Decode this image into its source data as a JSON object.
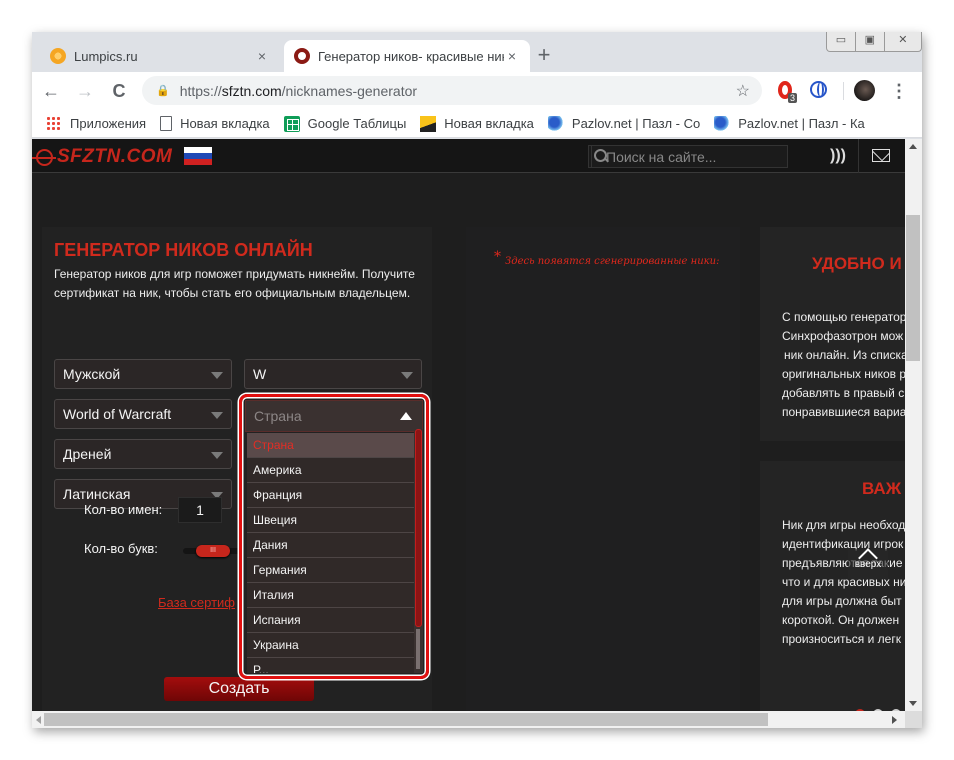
{
  "browser": {
    "tabs": [
      {
        "title": "Lumpics.ru",
        "favicon_color": "#f5a623",
        "active": false
      },
      {
        "title": "Генератор ников- красивые ник",
        "favicon_color": "#8b1a14",
        "active": true
      }
    ],
    "new_tab_label": "+",
    "close_glyph": "×",
    "window_controls": {
      "minimize": "▭",
      "maximize": "▣",
      "close": "✕"
    },
    "nav": {
      "back": "←",
      "forward": "→",
      "reload": "C"
    },
    "url": {
      "scheme": "https://",
      "host": "sfztn.com",
      "path": "/nicknames-generator"
    },
    "star_glyph": "☆",
    "opera_badge": "3",
    "menu_glyph": "⋮",
    "bookmarks": [
      {
        "label": "Приложения",
        "icon": "apps-grid-icon"
      },
      {
        "label": "Новая вкладка",
        "icon": "page-icon"
      },
      {
        "label": "Google Таблицы",
        "icon": "google-sheets-icon"
      },
      {
        "label": "Новая вкладка",
        "icon": "image-icon"
      },
      {
        "label": "Pazlov.net | Пазл - Со",
        "icon": "puzzle-icon"
      },
      {
        "label": "Pazlov.net | Пазл - Ка",
        "icon": "puzzle-icon"
      }
    ]
  },
  "site": {
    "logo_text": "SFZTN.COM",
    "search_placeholder": "Поиск на сайте...",
    "rss_glyph": "◥"
  },
  "generator": {
    "title": "ГЕНЕРАТОР НИКОВ ОНЛАЙН",
    "description": "Генератор ников для игр поможет придумать никнейм. Получите сертификат на ник, чтобы стать его официальным владельцем.",
    "selects": {
      "gender": "Мужской",
      "letter": "W",
      "game": "World of Warcraft",
      "race": "Дреней",
      "alphabet": "Латинская"
    },
    "country_dropdown": {
      "placeholder": "Страна",
      "selected": "Страна",
      "options": [
        "Страна",
        "Америка",
        "Франция",
        "Швеция",
        "Дания",
        "Германия",
        "Италия",
        "Испания",
        "Украина",
        "Р..."
      ],
      "scroll_position": 0.0
    },
    "names_count_label": "Кол-во имен:",
    "names_count_value": "1",
    "letters_count_label": "Кол-во букв:",
    "slider_handle_glyph": "III",
    "cert_link": "База сертиф",
    "create_button": "Создать"
  },
  "results": {
    "note_star": "*",
    "note": "Здесь появятся сгенерированные ники:"
  },
  "sidebar": {
    "block1": {
      "title": "УДОБНО И",
      "lines": [
        "С помощью генератор",
        "Синхрофазотрон мож",
        "ник онлайн. Из списка",
        "оригинальных ников р",
        "добавлять в правый с",
        "понравившиеся вариа"
      ]
    },
    "block2": {
      "title": "ВАЖ",
      "lines": [
        "Ник для игры необход",
        "идентификации игрок",
        "предъявляются такие",
        "что и для красивых ни",
        "для игры должна быт",
        "короткой. Он должен",
        "произноситься и легк"
      ]
    },
    "up_button": "вверх",
    "slider_dots": {
      "count": 3,
      "active_index": 0
    }
  },
  "colors": {
    "accent_red": "#d02a1d",
    "page_bg": "#1e1e1e",
    "highlight_border": "#e01010"
  }
}
